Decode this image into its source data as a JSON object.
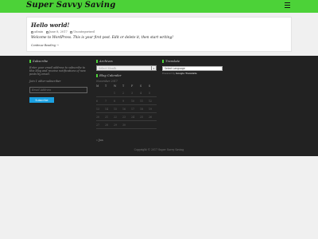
{
  "header": {
    "site_title": "Super Savvy Saving",
    "menu_icon": "hamburger-menu-icon"
  },
  "post": {
    "title": "Hello world!",
    "author": "admin",
    "date": "June 8, 2017",
    "category": "Uncategorized",
    "body": "Welcome to WordPress. This is your first post. Edit or delete it, then start writing!",
    "continue_label": "Continue Reading →"
  },
  "footer": {
    "subscribe": {
      "title": "Subscribe",
      "description": "Enter your email address to subscribe to this blog and receive notifications of new posts by email.",
      "join_text": "Join 1 other subscriber",
      "email_placeholder": "Email Address",
      "button_label": "Subscribe"
    },
    "archives": {
      "title": "Archives",
      "select_placeholder": "Select Month"
    },
    "calendar": {
      "title": "Blog Calendar",
      "caption": "November 2017",
      "weekdays": [
        "M",
        "T",
        "W",
        "T",
        "F",
        "S",
        "S"
      ],
      "weeks": [
        [
          "",
          "",
          "1",
          "2",
          "3",
          "4",
          "5"
        ],
        [
          "6",
          "7",
          "8",
          "9",
          "10",
          "11",
          "12"
        ],
        [
          "13",
          "14",
          "15",
          "16",
          "17",
          "18",
          "19"
        ],
        [
          "20",
          "21",
          "22",
          "23",
          "24",
          "25",
          "26"
        ],
        [
          "27",
          "28",
          "29",
          "30",
          "",
          "",
          ""
        ]
      ],
      "prev_label": "« Jun"
    },
    "translate": {
      "title": "Translate",
      "select_value": "Select Language",
      "powered_prefix": "Powered by",
      "powered_brand": "Google Translate"
    },
    "copyright": "Copyright © 2017 Super Savvy Saving"
  }
}
